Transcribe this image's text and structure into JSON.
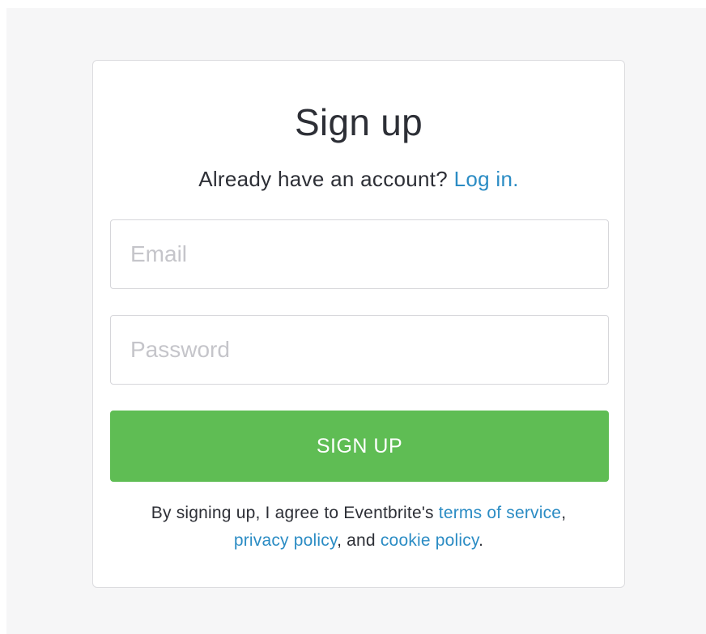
{
  "page": {
    "background_color": "#f6f6f7"
  },
  "card": {
    "title": "Sign up",
    "subtitle": {
      "text": "Already have an account? ",
      "link_label": "Log in."
    },
    "email": {
      "placeholder": "Email",
      "value": ""
    },
    "password": {
      "placeholder": "Password",
      "value": ""
    },
    "submit_label": "SIGN UP",
    "legal": {
      "prefix": "By signing up, I agree to Eventbrite's ",
      "terms_label": "terms of service",
      "separator1": ", ",
      "privacy_label": "privacy policy",
      "separator2": ", and ",
      "cookie_label": "cookie policy",
      "suffix": "."
    }
  },
  "colors": {
    "accent_green": "#5fbd54",
    "link_blue": "#2b8cc4",
    "text_dark": "#2d2f36",
    "border": "#dcdcdf",
    "placeholder": "#c5c5ca"
  }
}
